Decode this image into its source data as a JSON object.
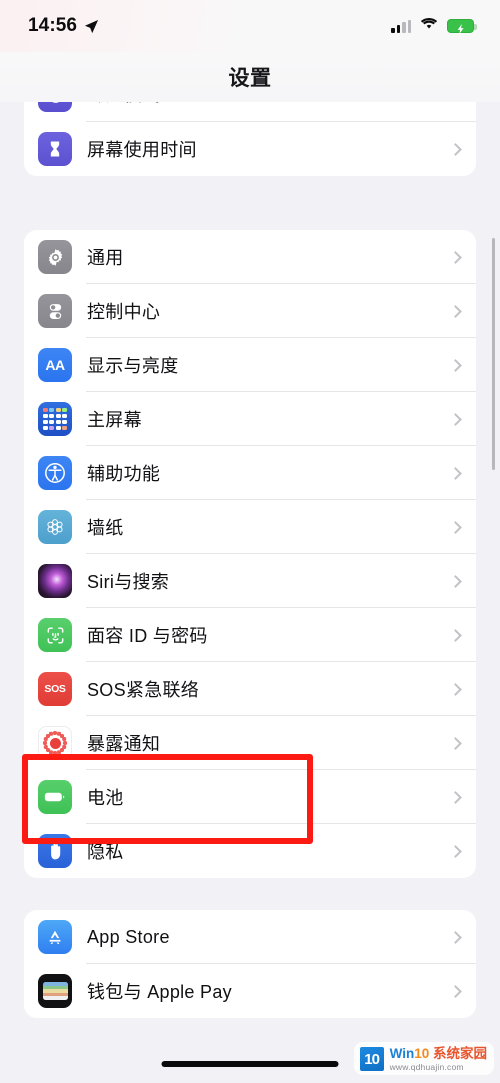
{
  "status_bar": {
    "time": "14:56",
    "location_icon": "location-arrow-icon",
    "signal_icon": "cellular-signal-icon",
    "wifi_icon": "wifi-icon",
    "battery_icon": "battery-charging-icon",
    "battery_state": "charging"
  },
  "nav": {
    "title": "设置"
  },
  "sections": [
    {
      "name": "section-focus",
      "rows": [
        {
          "label": "专注模式",
          "icon": "focus-mode-icon",
          "chevron": "chevron-right-icon",
          "clipped": true
        },
        {
          "label": "屏幕使用时间",
          "icon": "screen-time-icon",
          "chevron": "chevron-right-icon"
        }
      ]
    },
    {
      "name": "section-system",
      "rows": [
        {
          "label": "通用",
          "icon": "gear-icon",
          "chevron": "chevron-right-icon"
        },
        {
          "label": "控制中心",
          "icon": "control-center-icon",
          "chevron": "chevron-right-icon"
        },
        {
          "label": "显示与亮度",
          "icon": "display-brightness-icon",
          "chevron": "chevron-right-icon"
        },
        {
          "label": "主屏幕",
          "icon": "home-screen-icon",
          "chevron": "chevron-right-icon"
        },
        {
          "label": "辅助功能",
          "icon": "accessibility-icon",
          "chevron": "chevron-right-icon"
        },
        {
          "label": "墙纸",
          "icon": "wallpaper-icon",
          "chevron": "chevron-right-icon"
        },
        {
          "label": "Siri与搜索",
          "icon": "siri-icon",
          "chevron": "chevron-right-icon"
        },
        {
          "label": "面容 ID 与密码",
          "icon": "face-id-icon",
          "chevron": "chevron-right-icon"
        },
        {
          "label": "SOS紧急联络",
          "icon": "sos-icon",
          "chevron": "chevron-right-icon"
        },
        {
          "label": "暴露通知",
          "icon": "exposure-notification-icon",
          "chevron": "chevron-right-icon"
        },
        {
          "label": "电池",
          "icon": "battery-icon",
          "chevron": "chevron-right-icon",
          "highlighted": true
        },
        {
          "label": "隐私",
          "icon": "privacy-hand-icon",
          "chevron": "chevron-right-icon"
        }
      ]
    },
    {
      "name": "section-store",
      "rows": [
        {
          "label": "App Store",
          "icon": "app-store-icon",
          "chevron": "chevron-right-icon"
        },
        {
          "label": "钱包与 Apple Pay",
          "icon": "wallet-icon",
          "chevron": "chevron-right-icon"
        }
      ]
    }
  ],
  "annotation": {
    "name": "battery-row-highlight",
    "color": "#fb1b12",
    "target": "电池"
  },
  "watermark": {
    "logo": "10",
    "brand_prefix": "Win",
    "brand_number": "10",
    "brand_suffix": "系统家园",
    "url": "www.qdhuajin.com"
  },
  "home_indicator": "home-indicator"
}
